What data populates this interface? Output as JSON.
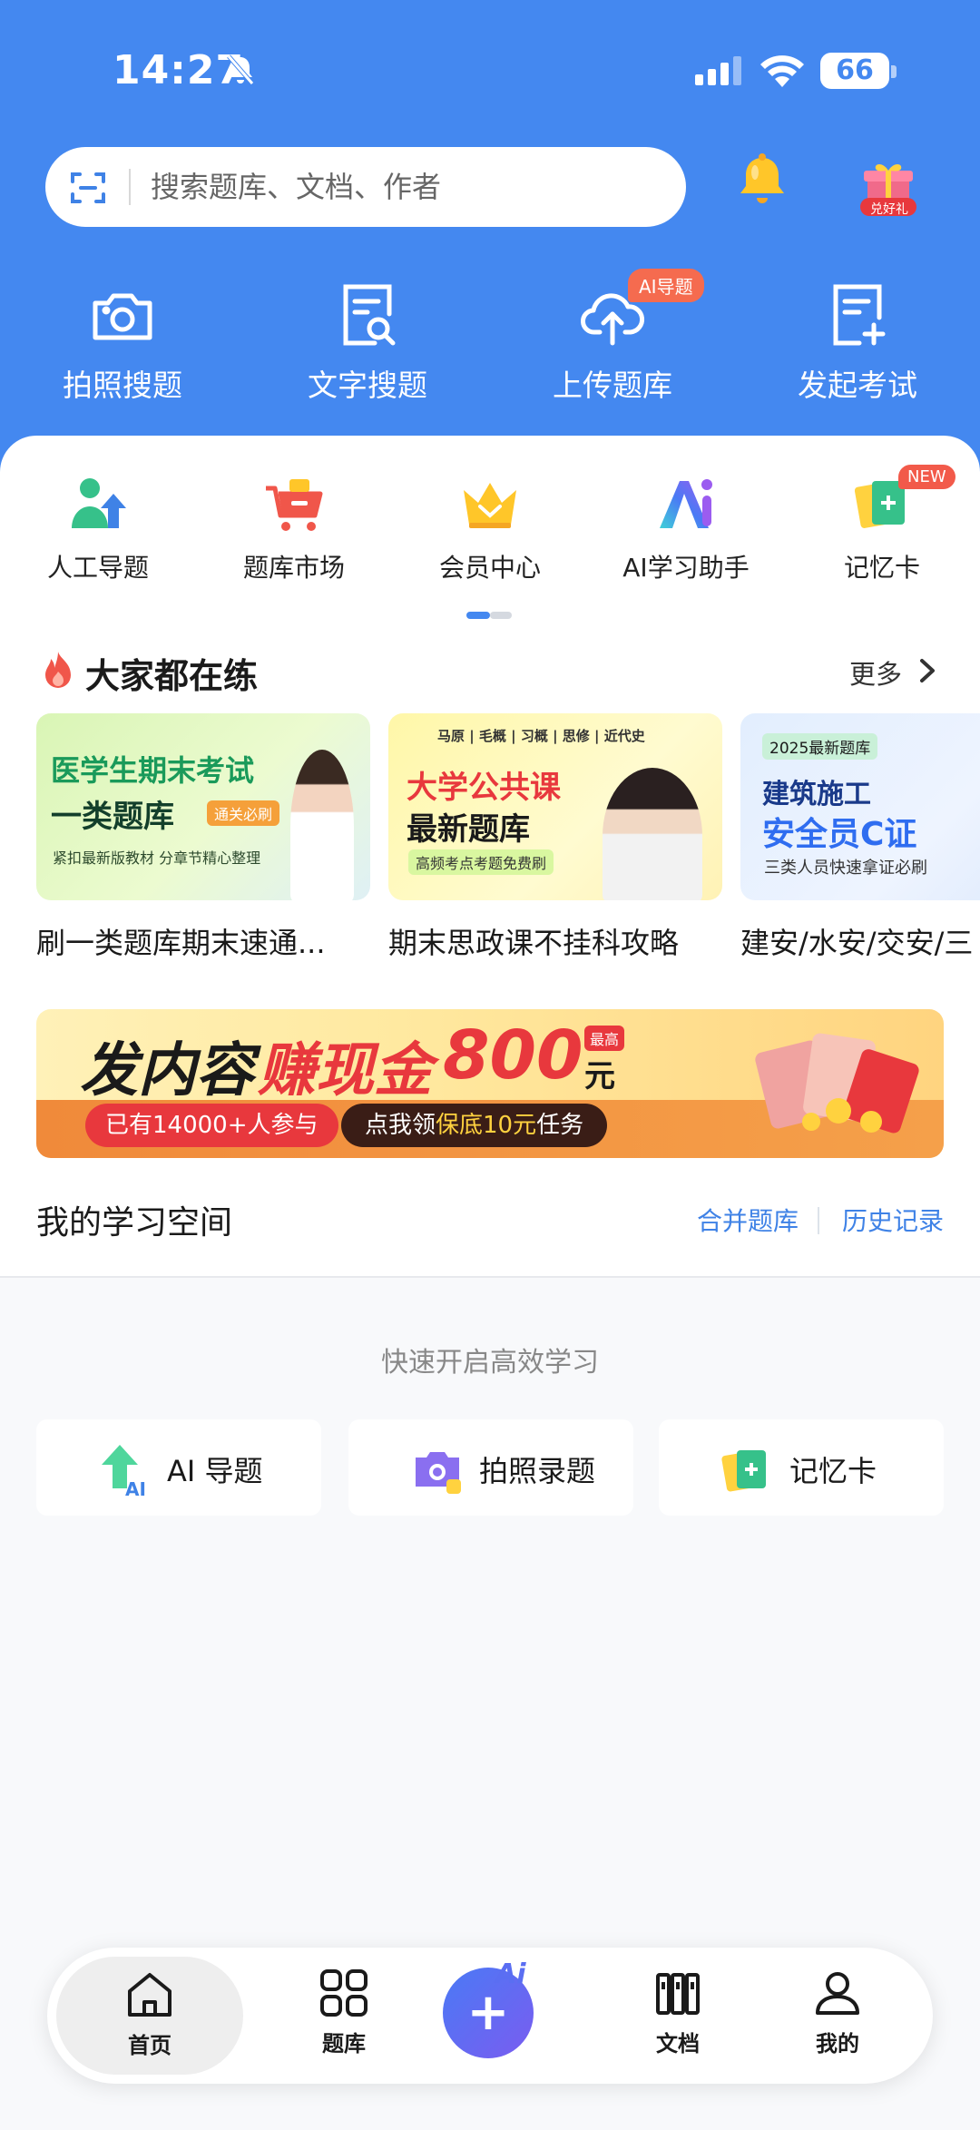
{
  "status_bar": {
    "time": "14:27",
    "battery": "66"
  },
  "search": {
    "placeholder": "搜索题库、文档、作者"
  },
  "gift_badge": "兑好礼",
  "quick_actions": [
    {
      "label": "拍照搜题",
      "icon": "camera-icon"
    },
    {
      "label": "文字搜题",
      "icon": "doc-search-icon"
    },
    {
      "label": "上传题库",
      "icon": "cloud-upload-icon",
      "badge": "AI导题"
    },
    {
      "label": "发起考试",
      "icon": "doc-add-icon"
    }
  ],
  "features": [
    {
      "label": "人工导题",
      "icon": "person-upload-icon"
    },
    {
      "label": "题库市场",
      "icon": "cart-icon"
    },
    {
      "label": "会员中心",
      "icon": "crown-icon"
    },
    {
      "label": "AI学习助手",
      "icon": "ai-assistant-icon"
    },
    {
      "label": "记忆卡",
      "icon": "flashcard-icon",
      "badge": "NEW"
    }
  ],
  "practice": {
    "title": "大家都在练",
    "more": "更多",
    "cards": [
      {
        "caption": "刷一类题库期末速通...",
        "img_title1": "医学生期末考试",
        "img_title2": "一类题库",
        "img_tag": "通关必刷",
        "img_sub": "紧扣最新版教材 分章节精心整理"
      },
      {
        "caption": "期末思政课不挂科攻略",
        "img_top": "马原 | 毛概 | 习概 | 思修 | 近代史",
        "img_title1": "大学公共课",
        "img_title2": "最新题库",
        "img_sub": "高频考点考题免费刷"
      },
      {
        "caption": "建安/水安/交安/三",
        "img_tag": "2025最新题库",
        "img_title1": "建筑施工",
        "img_title2": "安全员C证",
        "img_sub": "三类人员快速拿证必刷"
      }
    ]
  },
  "banner": {
    "text1": "发内容",
    "text2": "赚现金",
    "amount": "800",
    "unit": "元",
    "tag": "最高",
    "participants": "已有14000+人参与",
    "cta_prefix": "点我领",
    "cta_highlight": "保底10元",
    "cta_suffix": "任务"
  },
  "study_space": {
    "title": "我的学习空间",
    "merge": "合并题库",
    "history": "历史记录",
    "hint": "快速开启高效学习",
    "buttons": [
      {
        "label": "AI 导题",
        "icon": "ai-import-icon"
      },
      {
        "label": "拍照录题",
        "icon": "camera-entry-icon"
      },
      {
        "label": "记忆卡",
        "icon": "flashcard-icon"
      }
    ]
  },
  "tabbar": [
    {
      "label": "首页",
      "icon": "home-icon",
      "active": true
    },
    {
      "label": "题库",
      "icon": "grid-icon"
    },
    {
      "label": "",
      "icon": "ai-plus-icon",
      "fab_text": "Ai"
    },
    {
      "label": "文档",
      "icon": "books-icon"
    },
    {
      "label": "我的",
      "icon": "user-icon"
    }
  ],
  "colors": {
    "primary": "#4488f0",
    "accent_red": "#e8383d",
    "link": "#3f82e6"
  }
}
